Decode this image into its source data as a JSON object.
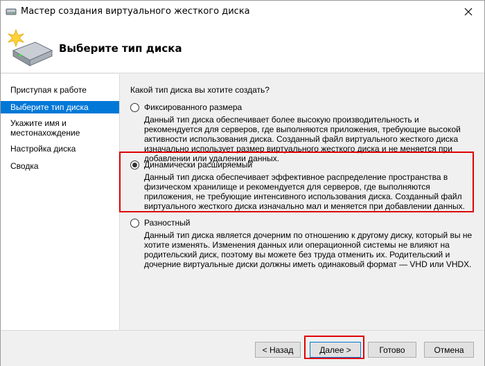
{
  "window": {
    "title": "Мастер создания виртуального жесткого диска"
  },
  "header": {
    "title": "Выберите тип диска"
  },
  "sidebar": {
    "items": [
      {
        "label": "Приступая к работе",
        "selected": false
      },
      {
        "label": "Выберите тип диска",
        "selected": true
      },
      {
        "label": "Укажите имя и местонахождение",
        "selected": false
      },
      {
        "label": "Настройка диска",
        "selected": false
      },
      {
        "label": "Сводка",
        "selected": false
      }
    ]
  },
  "main": {
    "question": "Какой тип диска вы хотите создать?",
    "options": [
      {
        "label": "Фиксированного размера",
        "checked": false,
        "description": "Данный тип диска обеспечивает более высокую производительность и рекомендуется для серверов, где выполняются приложения, требующие высокой активности использования диска. Созданный файл виртуального жесткого диска изначально использует размер виртуального жесткого диска и не меняется при добавлении или удалении данных."
      },
      {
        "label": "Динамически расширяемый",
        "checked": true,
        "description": "Данный тип диска обеспечивает эффективное распределение пространства в физическом хранилище и рекомендуется для серверов, где выполняются приложения, не требующие интенсивного использования диска. Созданный файл виртуального жесткого диска изначально мал и меняется при добавлении данных."
      },
      {
        "label": "Разностный",
        "checked": false,
        "description": "Данный тип диска является дочерним по отношению к другому диску, который вы не хотите изменять. Изменения данных или операционной системы не влияют на родительский диск, поэтому вы можете без труда отменить их. Родительский и дочерние виртуальные диски должны иметь одинаковый формат — VHD или VHDX."
      }
    ]
  },
  "footer": {
    "back_label": "< Назад",
    "next_label": "Далее >",
    "finish_label": "Готово",
    "cancel_label": "Отмена"
  },
  "colors": {
    "selection": "#0078d7",
    "annotation": "#e00000"
  }
}
